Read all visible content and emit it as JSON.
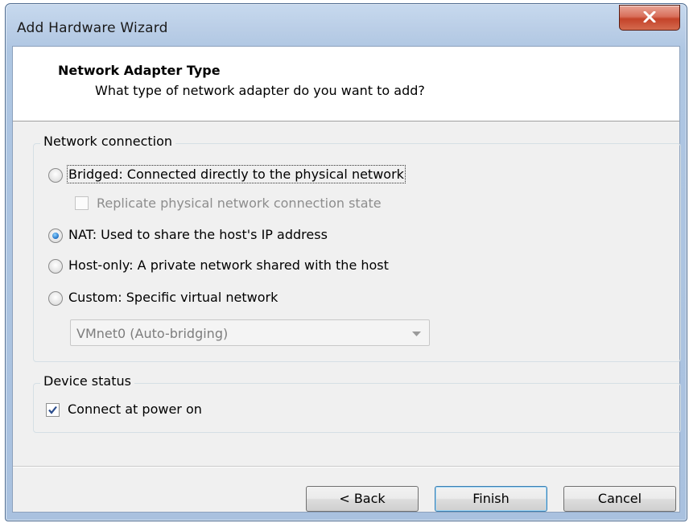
{
  "window": {
    "title": "Add Hardware Wizard"
  },
  "header": {
    "title": "Network Adapter Type",
    "subtitle": "What type of network adapter do you want to add?"
  },
  "network_connection": {
    "label": "Network connection",
    "options": [
      {
        "label": "Bridged: Connected directly to the physical network",
        "selected": false
      },
      {
        "label": "NAT: Used to share the host's IP address",
        "selected": true
      },
      {
        "label": "Host-only: A private network shared with the host",
        "selected": false
      },
      {
        "label": "Custom: Specific virtual network",
        "selected": false
      }
    ],
    "replicate": {
      "label": "Replicate physical network connection state",
      "checked": false,
      "enabled": false
    },
    "custom_network": {
      "selected": "VMnet0 (Auto-bridging)",
      "enabled": false
    }
  },
  "device_status": {
    "label": "Device status",
    "connect_at_power_on": {
      "label": "Connect at power on",
      "checked": true
    }
  },
  "buttons": {
    "back": "< Back",
    "finish": "Finish",
    "cancel": "Cancel"
  },
  "colors": {
    "accent_close": "#c4432a",
    "radio_selected": "#1f6fc5",
    "check_mark": "#2a4c8c"
  },
  "icons": {
    "close": "close-x-icon",
    "dropdown": "chevron-down-icon",
    "check": "checkmark-icon"
  }
}
